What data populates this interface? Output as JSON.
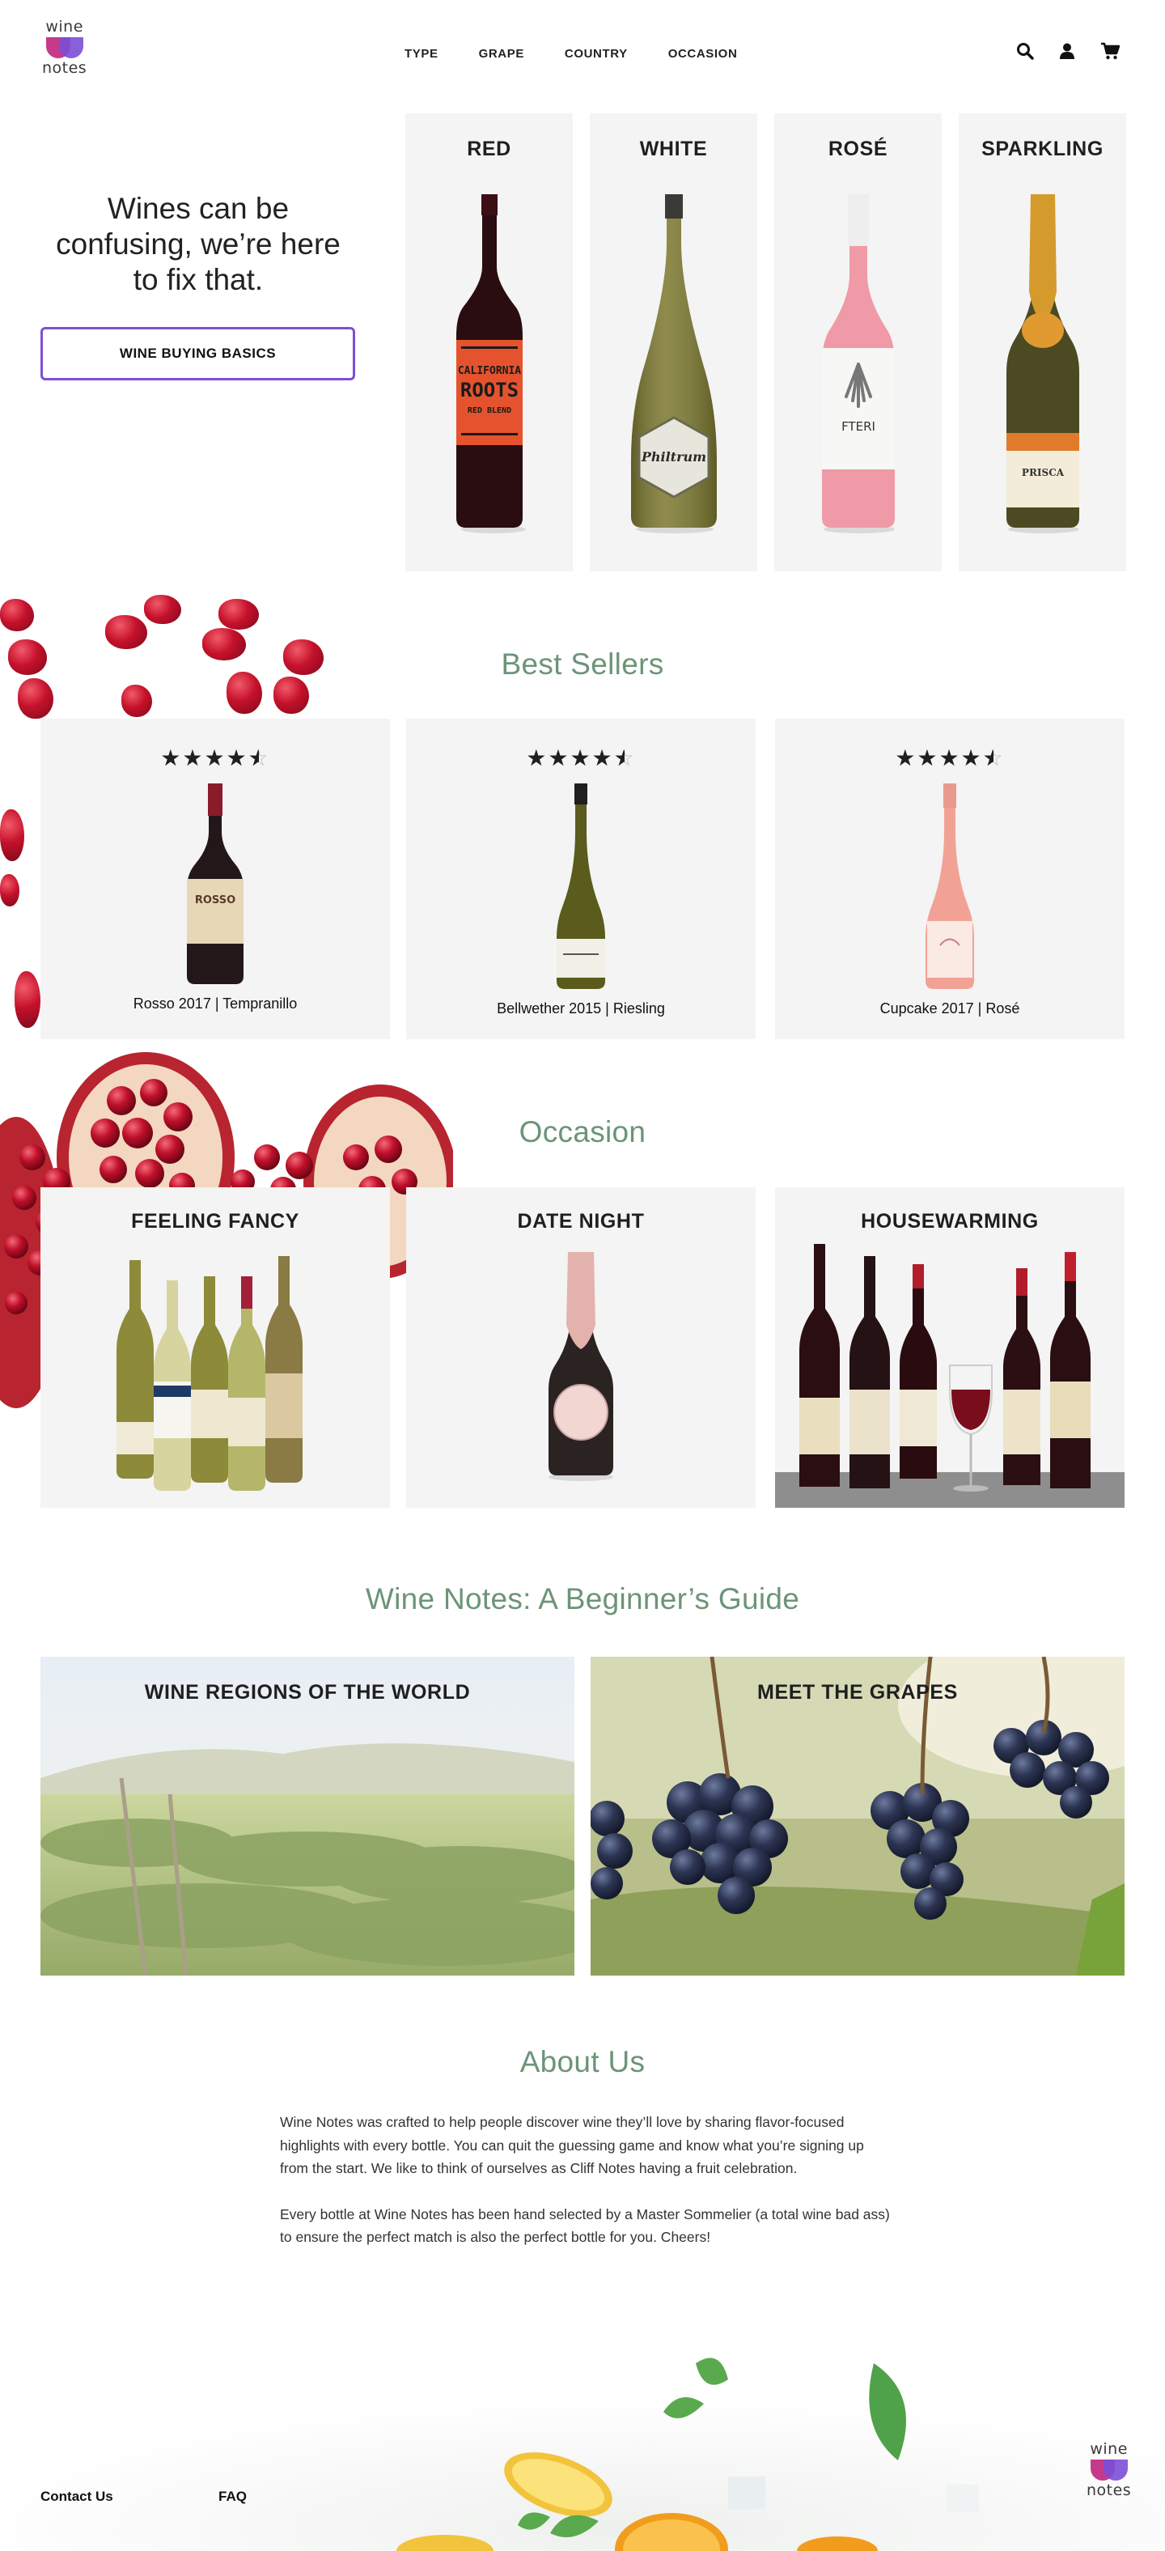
{
  "brand": {
    "logo_top_word": "wine",
    "logo_bottom_word": "notes"
  },
  "nav": {
    "items": [
      "TYPE",
      "GRAPE",
      "COUNTRY",
      "OCCASION"
    ]
  },
  "nav_icons": [
    "search-icon",
    "account-icon",
    "cart-icon"
  ],
  "hero": {
    "headline": "Wines can be confusing, we’re here to fix that.",
    "button_label": "WINE BUYING BASICS"
  },
  "types": [
    {
      "label": "RED"
    },
    {
      "label": "WHITE"
    },
    {
      "label": "ROSÉ"
    },
    {
      "label": "SPARKLING"
    }
  ],
  "type_bottle_labels": {
    "red": [
      "CALIFORNIA",
      "ROOTS",
      "RED BLEND"
    ],
    "white": "Philtrum",
    "rose": "FTERI",
    "sparkling": "PRISCA"
  },
  "best_sellers": {
    "title": "Best Sellers",
    "items": [
      {
        "rating": 4.5,
        "name": "Rosso 2017 | Tempranillo",
        "bottle_label": "ROSSO"
      },
      {
        "rating": 4.5,
        "name": "Bellwether 2015 | Riesling"
      },
      {
        "rating": 4.5,
        "name": "Cupcake 2017 | Rosé"
      }
    ]
  },
  "occasion": {
    "title": "Occasion",
    "items": [
      {
        "label": "FEELING FANCY"
      },
      {
        "label": "DATE NIGHT"
      },
      {
        "label": "HOUSEWARMING"
      }
    ]
  },
  "guide": {
    "title": "Wine Notes: A Beginner’s Guide",
    "items": [
      {
        "label": "WINE REGIONS OF THE WORLD"
      },
      {
        "label": "MEET THE GRAPES"
      }
    ]
  },
  "about": {
    "title": "About Us",
    "paragraphs": [
      "Wine Notes was crafted to help people discover wine they’ll love by sharing flavor-focused highlights with every bottle. You can quit the guessing game and know what you’re signing up from the start. We like to think of ourselves as Cliff Notes having a fruit celebration.",
      "Every bottle at Wine Notes has been hand selected by a Master Sommelier (a total wine bad ass) to ensure the perfect match is also the perfect bottle for you. Cheers!"
    ]
  },
  "footer": {
    "links": [
      "Contact Us",
      "FAQ"
    ]
  },
  "colors": {
    "accent": "#7e4fd4",
    "section_title": "#6c9478",
    "card_bg": "#f3f4f3",
    "logo_pink": "#c63a8c",
    "logo_purple": "#7b4fd6"
  }
}
